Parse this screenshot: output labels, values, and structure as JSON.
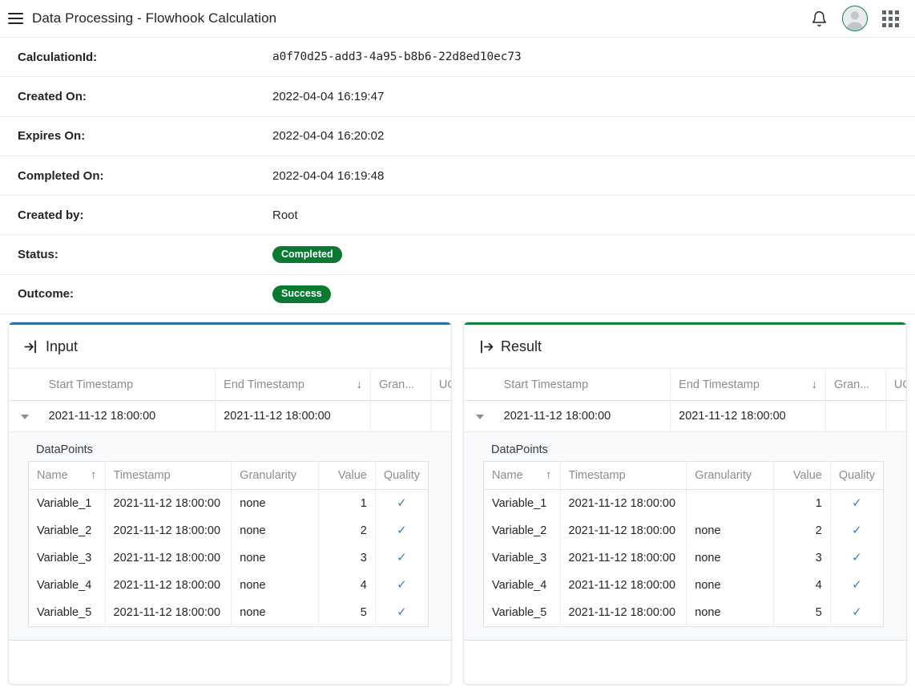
{
  "appbar": {
    "menu_icon": "hamburger-icon",
    "title": "Data Processing - Flowhook Calculation",
    "notifications_icon": "bell-icon",
    "avatar_icon": "user-avatar-icon",
    "apps_icon": "grid-apps-icon"
  },
  "metadata": [
    {
      "label": "CalculationId:",
      "value": "a0f70d25-add3-4a95-b8b6-22d8ed10ec73",
      "type": "mono"
    },
    {
      "label": "Created On:",
      "value": "2022-04-04 16:19:47",
      "type": "text"
    },
    {
      "label": "Expires On:",
      "value": "2022-04-04 16:20:02",
      "type": "text"
    },
    {
      "label": "Completed On:",
      "value": "2022-04-04 16:19:48",
      "type": "text"
    },
    {
      "label": "Created by:",
      "value": "Root",
      "type": "text"
    },
    {
      "label": "Status:",
      "value": "Completed",
      "type": "badge"
    },
    {
      "label": "Outcome:",
      "value": "Success",
      "type": "badge"
    }
  ],
  "colors": {
    "badge_green": "#0a7a33",
    "input_accent": "#2f6fa8",
    "result_accent": "#15803d",
    "check_blue": "#2f7fd0",
    "avatar_ring": "#13824a"
  },
  "input_card": {
    "title": "Input",
    "icon": "sign-in-arrow-icon",
    "columns": {
      "start": "Start Timestamp",
      "end": "End Timestamp",
      "end_sort": "↓",
      "granularity": "Gran...",
      "uom": "UOM ..."
    },
    "row": {
      "start": "2021-11-12 18:00:00",
      "end": "2021-11-12 18:00:00",
      "granularity": "",
      "uom": ""
    },
    "detail": {
      "label": "DataPoints",
      "columns": {
        "name": "Name",
        "name_sort": "↑",
        "timestamp": "Timestamp",
        "granularity": "Granularity",
        "value": "Value",
        "quality": "Quality"
      },
      "rows": [
        {
          "name": "Variable_1",
          "timestamp": "2021-11-12 18:00:00",
          "granularity": "none",
          "value": "1",
          "quality": "✓"
        },
        {
          "name": "Variable_2",
          "timestamp": "2021-11-12 18:00:00",
          "granularity": "none",
          "value": "2",
          "quality": "✓"
        },
        {
          "name": "Variable_3",
          "timestamp": "2021-11-12 18:00:00",
          "granularity": "none",
          "value": "3",
          "quality": "✓"
        },
        {
          "name": "Variable_4",
          "timestamp": "2021-11-12 18:00:00",
          "granularity": "none",
          "value": "4",
          "quality": "✓"
        },
        {
          "name": "Variable_5",
          "timestamp": "2021-11-12 18:00:00",
          "granularity": "none",
          "value": "5",
          "quality": "✓"
        }
      ]
    }
  },
  "result_card": {
    "title": "Result",
    "icon": "sign-out-arrow-icon",
    "columns": {
      "start": "Start Timestamp",
      "end": "End Timestamp",
      "end_sort": "↓",
      "granularity": "Gran...",
      "uom": "UOM ..."
    },
    "row": {
      "start": "2021-11-12 18:00:00",
      "end": "2021-11-12 18:00:00",
      "granularity": "",
      "uom": ""
    },
    "detail": {
      "label": "DataPoints",
      "columns": {
        "name": "Name",
        "name_sort": "↑",
        "timestamp": "Timestamp",
        "granularity": "Granularity",
        "value": "Value",
        "quality": "Quality"
      },
      "rows": [
        {
          "name": "Variable_1",
          "timestamp": "2021-11-12 18:00:00",
          "granularity": "",
          "value": "1",
          "quality": "✓"
        },
        {
          "name": "Variable_2",
          "timestamp": "2021-11-12 18:00:00",
          "granularity": "none",
          "value": "2",
          "quality": "✓"
        },
        {
          "name": "Variable_3",
          "timestamp": "2021-11-12 18:00:00",
          "granularity": "none",
          "value": "3",
          "quality": "✓"
        },
        {
          "name": "Variable_4",
          "timestamp": "2021-11-12 18:00:00",
          "granularity": "none",
          "value": "4",
          "quality": "✓"
        },
        {
          "name": "Variable_5",
          "timestamp": "2021-11-12 18:00:00",
          "granularity": "none",
          "value": "5",
          "quality": "✓"
        }
      ]
    }
  }
}
